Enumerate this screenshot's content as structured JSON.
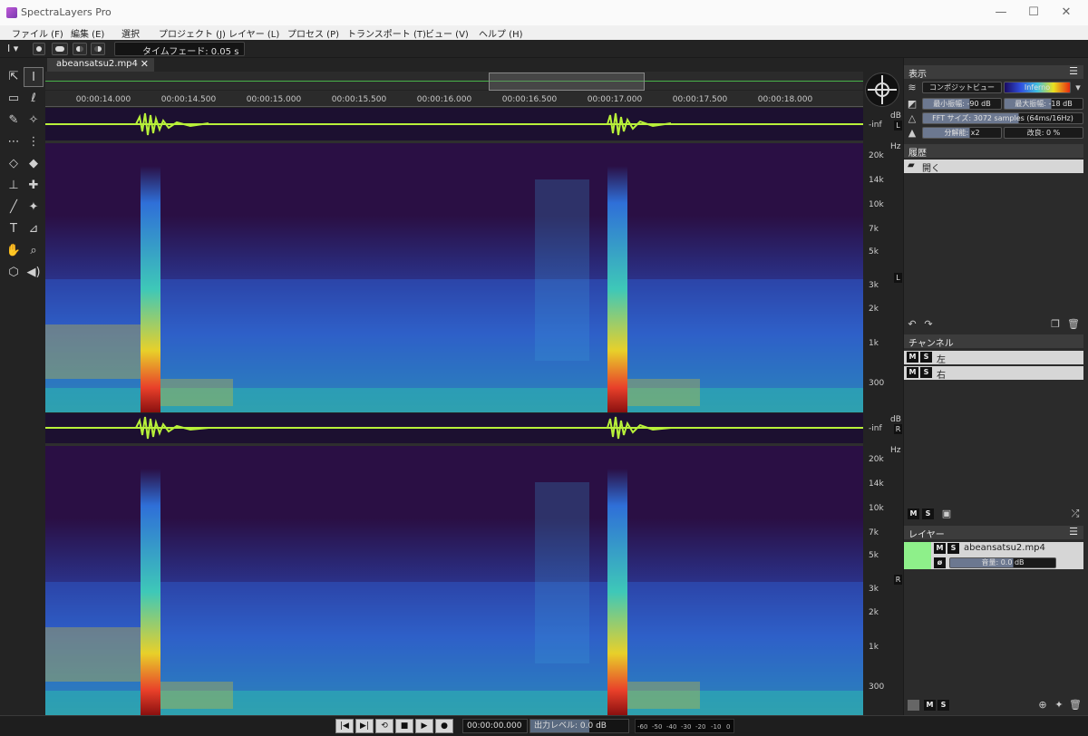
{
  "window": {
    "title": "SpectraLayers Pro",
    "minimize": "—",
    "maximize": "☐",
    "close": "✕"
  },
  "menu": [
    {
      "label": "ファイル (F)"
    },
    {
      "label": "編集 (E)"
    },
    {
      "label": "選択"
    },
    {
      "label": "プロジェクト (J)"
    },
    {
      "label": "レイヤー (L)"
    },
    {
      "label": "プロセス (P)"
    },
    {
      "label": "トランスポート (T)"
    },
    {
      "label": "ビュー (V)"
    },
    {
      "label": "ヘルプ (H)"
    }
  ],
  "optionbar": {
    "time_fade": "タイムフェード: 0.05 s"
  },
  "document": {
    "tab_label": "abeansatsu2.mp4",
    "tab_close": "✕"
  },
  "timeline": {
    "ticks": [
      "00:00:14.000",
      "00:00:14.500",
      "00:00:15.000",
      "00:00:15.500",
      "00:00:16.000",
      "00:00:16.500",
      "00:00:17.000",
      "00:00:17.500",
      "00:00:18.000"
    ]
  },
  "channels": [
    {
      "badge": "L",
      "db_unit": "dB",
      "inf_label": "-inf",
      "hz_unit": "Hz",
      "hz_ticks": [
        "20k",
        "14k",
        "10k",
        "7k",
        "5k",
        "3k",
        "2k",
        "1k",
        "300"
      ]
    },
    {
      "badge": "R",
      "db_unit": "dB",
      "inf_label": "-inf",
      "hz_unit": "Hz",
      "hz_ticks": [
        "20k",
        "14k",
        "10k",
        "7k",
        "5k",
        "3k",
        "2k",
        "1k",
        "300"
      ]
    }
  ],
  "panels": {
    "display": {
      "title": "表示",
      "view_mode": "コンポジットビュー",
      "colormap": "Inferno",
      "min_amp": "最小振幅: -90 dB",
      "max_amp": "最大振幅: -18 dB",
      "fft_size": "FFT サイズ: 3072 samples (64ms/16Hz)",
      "resolution": "分解能: x2",
      "improve": "改良: 0 %"
    },
    "history": {
      "title": "履歴",
      "items": [
        {
          "label": "開く"
        }
      ]
    },
    "channels": {
      "title": "チャンネル",
      "items": [
        {
          "label": "左"
        },
        {
          "label": "右"
        }
      ]
    },
    "layers": {
      "title": "レイヤー",
      "items": [
        {
          "label": "abeansatsu2.mp4",
          "volume": "音量: 0.0 dB"
        }
      ]
    },
    "ms": {
      "m": "M",
      "s": "S"
    }
  },
  "transport": {
    "time": "00:00:00.000",
    "output_level": "出力レベル: 0.0 dB",
    "meter_ticks": [
      "-60",
      "-50",
      "-40",
      "-30",
      "-20",
      "-10",
      "0"
    ]
  },
  "colors": {
    "spectrogram_bg": "#2a0f44",
    "waveform": "#b8f03a",
    "overview_line": "#48b24a",
    "layer_swatch": "#8ef08a"
  }
}
